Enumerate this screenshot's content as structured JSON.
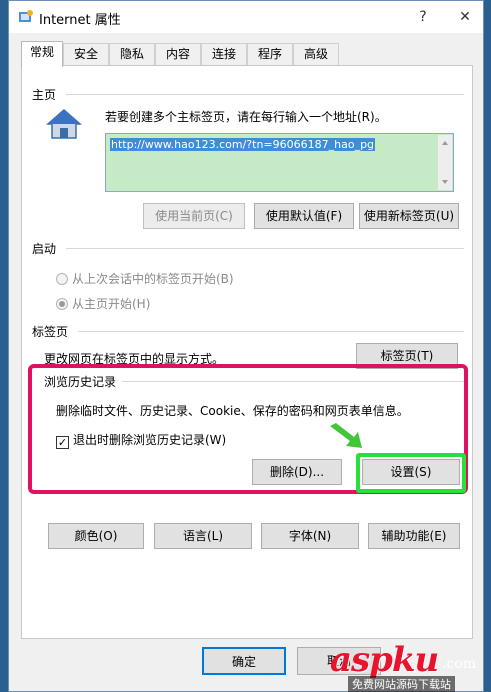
{
  "window": {
    "title": "Internet 属性",
    "help": "?",
    "close": "✕"
  },
  "tabs": [
    "常规",
    "安全",
    "隐私",
    "内容",
    "连接",
    "程序",
    "高级"
  ],
  "home": {
    "label": "主页",
    "instruction": "若要创建多个主标签页，请在每行输入一个地址(R)。",
    "url": "http://www.hao123.com/?tn=96066187_hao_pg",
    "btn_current": "使用当前页(C)",
    "btn_default": "使用默认值(F)",
    "btn_newtab": "使用新标签页(U)"
  },
  "startup": {
    "label": "启动",
    "opt_last": "从上次会话中的标签页开始(B)",
    "opt_home": "从主页开始(H)"
  },
  "tabsgroup": {
    "label": "标签页",
    "desc": "更改网页在标签页中的显示方式。",
    "btn": "标签页(T)"
  },
  "history": {
    "label": "浏览历史记录",
    "desc": "删除临时文件、历史记录、Cookie、保存的密码和网页表单信息。",
    "checkbox": "退出时删除浏览历史记录(W)",
    "check_mark": "✓",
    "btn_delete": "删除(D)...",
    "btn_settings": "设置(S)"
  },
  "appearance": {
    "btn_colors": "颜色(O)",
    "btn_languages": "语言(L)",
    "btn_fonts": "字体(N)",
    "btn_accessibility": "辅助功能(E)"
  },
  "footer": {
    "ok": "确定",
    "cancel": "取消"
  },
  "watermark": {
    "brand": "aspku",
    "suffix": ".com",
    "sub": "免费网站源码下载站"
  },
  "colors": {
    "highlight": "#e0115f",
    "green": "#29e03a",
    "accent": "#0078d7"
  }
}
